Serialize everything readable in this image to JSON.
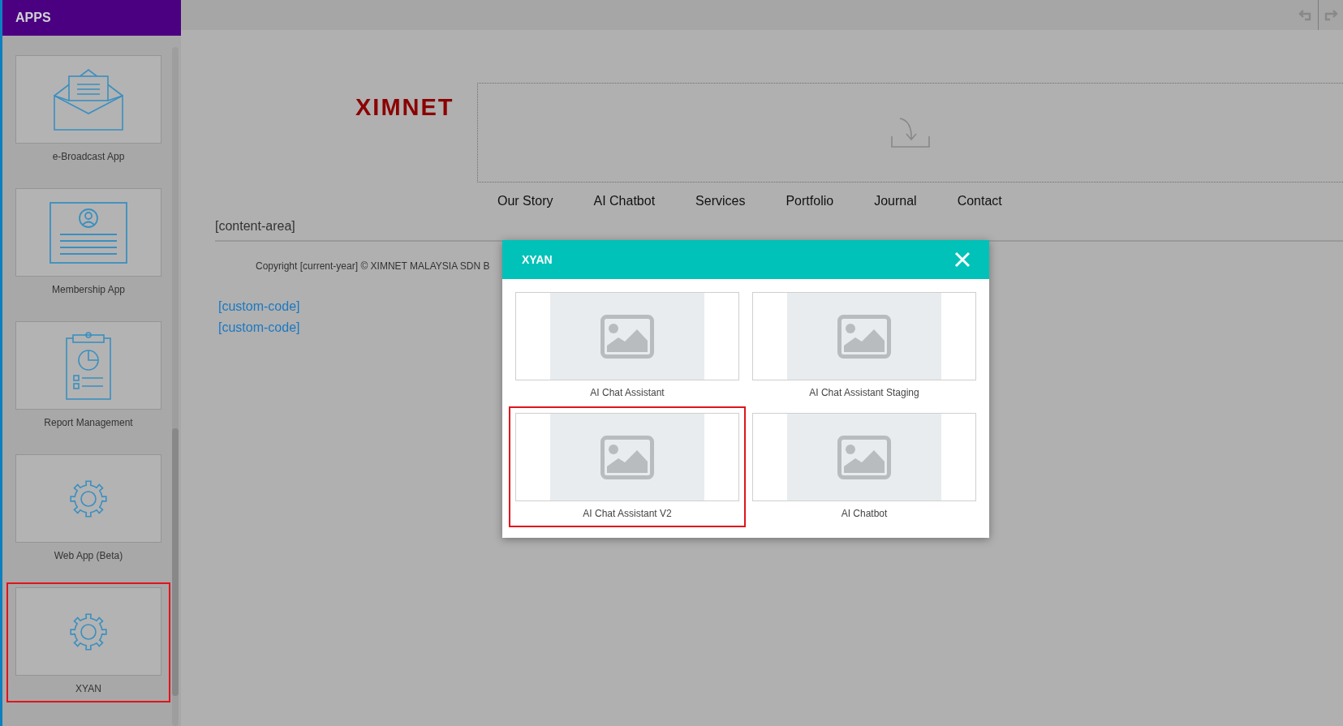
{
  "sidebar": {
    "title": "APPS",
    "apps": [
      {
        "label": "e-Broadcast App",
        "kind": "envelope",
        "selected": false
      },
      {
        "label": "Membership App",
        "kind": "profile",
        "selected": false
      },
      {
        "label": "Report Management",
        "kind": "report",
        "selected": false
      },
      {
        "label": "Web App (Beta)",
        "kind": "gear",
        "selected": false
      },
      {
        "label": "XYAN",
        "kind": "gear",
        "selected": true
      }
    ]
  },
  "site": {
    "logo": "XIMNET",
    "nav": [
      "Our Story",
      "AI Chatbot",
      "Services",
      "Portfolio",
      "Journal",
      "Contact"
    ],
    "content_placeholder": "[content-area]",
    "copyright": "Copyright [current-year] © XIMNET MALAYSIA SDN B",
    "custom_code": [
      "[custom-code]",
      "[custom-code]"
    ]
  },
  "dialog": {
    "title": "XYAN",
    "items": [
      {
        "label": "AI Chat Assistant",
        "selected": false
      },
      {
        "label": "AI Chat Assistant Staging",
        "selected": false
      },
      {
        "label": "AI Chat Assistant V2",
        "selected": true
      },
      {
        "label": "AI Chatbot",
        "selected": false
      }
    ]
  }
}
